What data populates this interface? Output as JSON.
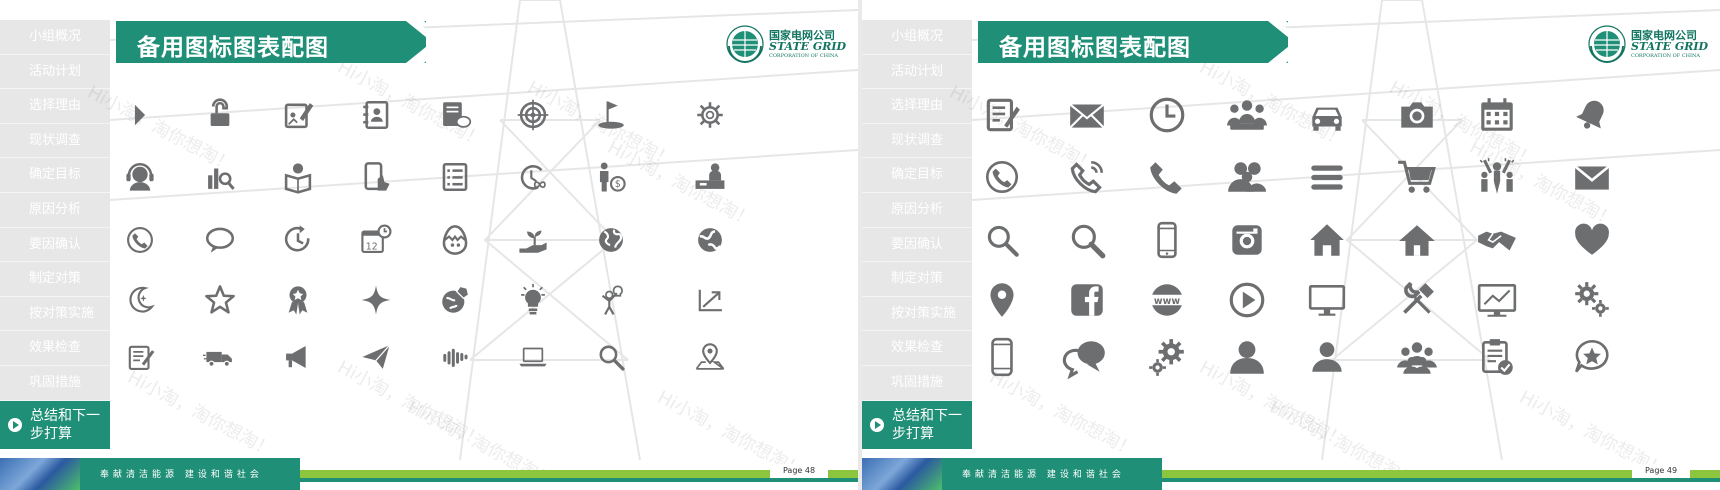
{
  "slides": [
    {
      "title": "备用图标图表配图",
      "page": "Page 48",
      "slogan": "奉献清洁能源  建设和谐社会",
      "logo": {
        "cn": "国家电网公司",
        "en": "STATE GRID",
        "sub": "CORPORATION OF CHINA"
      },
      "watermark": "Hi小淘，淘你想淘！",
      "nav_items": [
        "小组概况",
        "活动计划",
        "选择理由",
        "现状调查",
        "确定目标",
        "原因分析",
        "要因确认",
        "制定对策",
        "按对策实施",
        "效果检查",
        "巩固措施"
      ],
      "nav_active": "总结和下一步打算",
      "icons": [
        "play-icon",
        "unlock-icon",
        "edit-image-icon",
        "contact-book-icon",
        "document-chat-icon",
        "target-icon",
        "golf-flag-icon",
        "gear-icon",
        "headset-user-icon",
        "bar-search-icon",
        "reading-person-icon",
        "mobile-touch-icon",
        "checklist-icon",
        "time-infinity-icon",
        "person-money-icon",
        "desk-person-icon",
        "phone-circle-icon",
        "speech-bubble-icon",
        "clock-refresh-icon",
        "calendar-clock-icon",
        "egg-chick-icon",
        "plant-hand-icon",
        "globe-icon",
        "earth-icon",
        "moon-icon",
        "star-icon",
        "award-badge-icon",
        "sparkle-icon",
        "globe-rocket-icon",
        "lightbulb-icon",
        "person-idea-icon",
        "growth-chart-icon",
        "notepad-icon",
        "delivery-truck-icon",
        "megaphone-icon",
        "paper-plane-icon",
        "voice-wave-icon",
        "laptop-icon",
        "search-icon",
        "map-pin-icon"
      ]
    },
    {
      "title": "备用图标图表配图",
      "page": "Page 49",
      "slogan": "奉献清洁能源  建设和谐社会",
      "logo": {
        "cn": "国家电网公司",
        "en": "STATE GRID",
        "sub": "CORPORATION OF CHINA"
      },
      "watermark": "Hi小淘，淘你想淘！",
      "nav_items": [
        "小组概况",
        "活动计划",
        "选择理由",
        "现状调查",
        "确定目标",
        "原因分析",
        "要因确认",
        "制定对策",
        "按对策实施",
        "效果检查",
        "巩固措施"
      ],
      "nav_active": "总结和下一步打算",
      "icons": [
        "form-edit-icon",
        "mail-icon",
        "clock-icon",
        "team-icon",
        "car-icon",
        "camera-icon",
        "calendar-icon",
        "bell-icon",
        "phone-circle-icon",
        "phone-ringing-icon",
        "phone-icon",
        "group-icon",
        "menu-icon",
        "shopping-cart-icon",
        "celebrate-crowd-icon",
        "envelope-icon",
        "search-icon",
        "search-outline-icon",
        "smartphone-icon",
        "instagram-icon",
        "home-icon",
        "house-icon",
        "handshake-icon",
        "heart-icon",
        "location-pin-icon",
        "facebook-icon",
        "www-icon",
        "play-circle-icon",
        "monitor-icon",
        "tools-icon",
        "chart-monitor-icon",
        "gears-icon",
        "mobile-icon",
        "chat-bubbles-icon",
        "settings-gears-icon",
        "user-silhouette-icon",
        "user-icon",
        "people-group-icon",
        "clipboard-check-icon",
        "star-chat-icon"
      ]
    }
  ],
  "colors": {
    "accent": "#1f8f77",
    "icon": "#6d6e70",
    "nav_bg": "#e7e7e7",
    "stripe": "#8cc63f"
  }
}
